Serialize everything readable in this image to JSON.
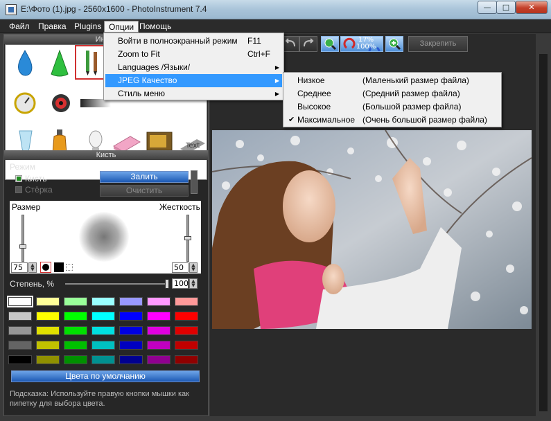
{
  "window": {
    "title": "E:\\Фото (1).jpg - 2560x1600 - PhotoInstrument 7.4",
    "minimize": "—",
    "maximize": "□",
    "close": "✕"
  },
  "menubar": {
    "items": [
      "Файл",
      "Правка",
      "Plugins",
      "Опции",
      "Помощь"
    ],
    "active": "Опции"
  },
  "options_menu": {
    "items": [
      {
        "label": "Войти в полноэкранный режим",
        "shortcut": "F11",
        "submenu": false
      },
      {
        "label": "Zoom to Fit",
        "shortcut": "Ctrl+F",
        "submenu": false
      },
      {
        "label": "Languages /Языки/",
        "shortcut": "",
        "submenu": true
      },
      {
        "label": "JPEG Качество",
        "shortcut": "",
        "submenu": true,
        "highlighted": true
      },
      {
        "label": "Стиль меню",
        "shortcut": "",
        "submenu": true
      }
    ]
  },
  "jpeg_submenu": {
    "items": [
      {
        "label": "Низкое",
        "desc": "(Маленький размер файла)",
        "checked": false
      },
      {
        "label": "Среднее",
        "desc": "(Средний размер файла)",
        "checked": false
      },
      {
        "label": "Высокое",
        "desc": "(Большой размер файла)",
        "checked": false
      },
      {
        "label": "Максимальное",
        "desc": "(Очень большой размер файла)",
        "checked": true
      }
    ]
  },
  "tools_panel": {
    "title": "Инстр",
    "selected_tool": "brush-tool"
  },
  "brush_panel": {
    "title": "Кисть",
    "mode_label": "Режим",
    "mode_brush": "Кисть",
    "mode_eraser": "Стёрка",
    "fill_button": "Залить",
    "clear_button": "Очистить",
    "size_label": "Размер",
    "hardness_label": "Жесткость",
    "size_value": "75",
    "hardness_value": "50",
    "opacity_label": "Степень, %",
    "opacity_value": "100",
    "default_colors_button": "Цвета по умолчанию",
    "hint": "Подсказка: Используйте правую кнопки мышки как пипетку для выбора цвета."
  },
  "palette": {
    "rows": [
      [
        "#ffffff",
        "#ffff99",
        "#99ff99",
        "#99ffff",
        "#9999ff",
        "#ff99ff",
        "#ff9999"
      ],
      [
        "#c8c8c8",
        "#ffff00",
        "#00ff00",
        "#00ffff",
        "#0000ff",
        "#ff00ff",
        "#ff0000"
      ],
      [
        "#969696",
        "#e0e000",
        "#00e000",
        "#00e0e0",
        "#0000e0",
        "#e000e0",
        "#e00000"
      ],
      [
        "#646464",
        "#c0c000",
        "#00c000",
        "#00c0c0",
        "#0000c0",
        "#c000c0",
        "#c00000"
      ],
      [
        "#000000",
        "#909000",
        "#009000",
        "#009090",
        "#000090",
        "#900090",
        "#900000"
      ]
    ],
    "selected": "#ffffff"
  },
  "toolbar": {
    "zoom_top": "17%",
    "zoom_bottom": "100%",
    "pin_button": "Закрепить"
  }
}
